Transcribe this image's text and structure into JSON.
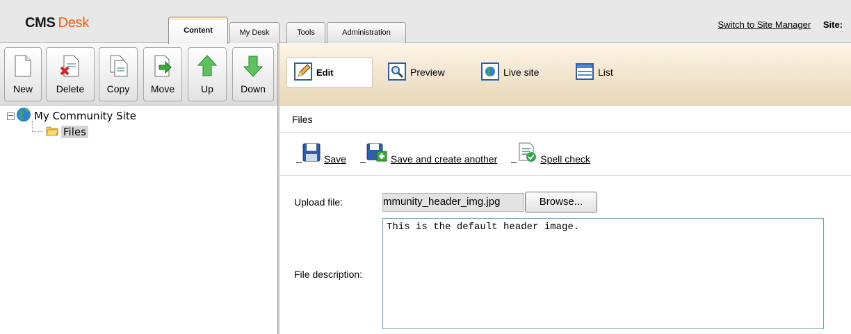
{
  "header": {
    "logo_bold": "CMS",
    "logo_accent": "Desk",
    "tabs": [
      {
        "label": "Content",
        "active": true
      },
      {
        "label": "My Desk",
        "active": false
      },
      {
        "label": "Tools",
        "active": false
      },
      {
        "label": "Administration",
        "active": false
      }
    ],
    "switch_link": "Switch to Site Manager",
    "site_label": "Site:"
  },
  "left_toolbar": {
    "buttons": [
      {
        "label": "New",
        "icon": "new-document-icon"
      },
      {
        "label": "Delete",
        "icon": "delete-document-icon"
      },
      {
        "label": "Copy",
        "icon": "copy-document-icon"
      },
      {
        "label": "Move",
        "icon": "move-document-icon"
      },
      {
        "label": "Up",
        "icon": "arrow-up-icon"
      },
      {
        "label": "Down",
        "icon": "arrow-down-icon"
      }
    ]
  },
  "view_modes": [
    {
      "label": "Edit",
      "icon": "edit-pencil-icon",
      "active": true
    },
    {
      "label": "Preview",
      "icon": "preview-magnifier-icon",
      "active": false
    },
    {
      "label": "Live site",
      "icon": "live-site-globe-icon",
      "active": false
    },
    {
      "label": "List",
      "icon": "list-icon",
      "active": false
    }
  ],
  "tree": {
    "root": {
      "label": "My Community Site",
      "icon": "globe-icon",
      "expander": "−"
    },
    "children": [
      {
        "label": "Files",
        "icon": "folder-icon",
        "selected": true
      }
    ]
  },
  "content": {
    "breadcrumb": "Files",
    "actions": [
      {
        "label": "Save",
        "icon": "save-disk-icon"
      },
      {
        "label": "Save and create another",
        "icon": "save-another-icon"
      },
      {
        "label": "Spell check",
        "icon": "spell-check-icon"
      }
    ],
    "form": {
      "upload_label": "Upload file:",
      "upload_value": "mmunity_header_img.jpg",
      "browse_label": "Browse...",
      "description_label": "File description:",
      "description_value": "This is the default header image."
    }
  }
}
